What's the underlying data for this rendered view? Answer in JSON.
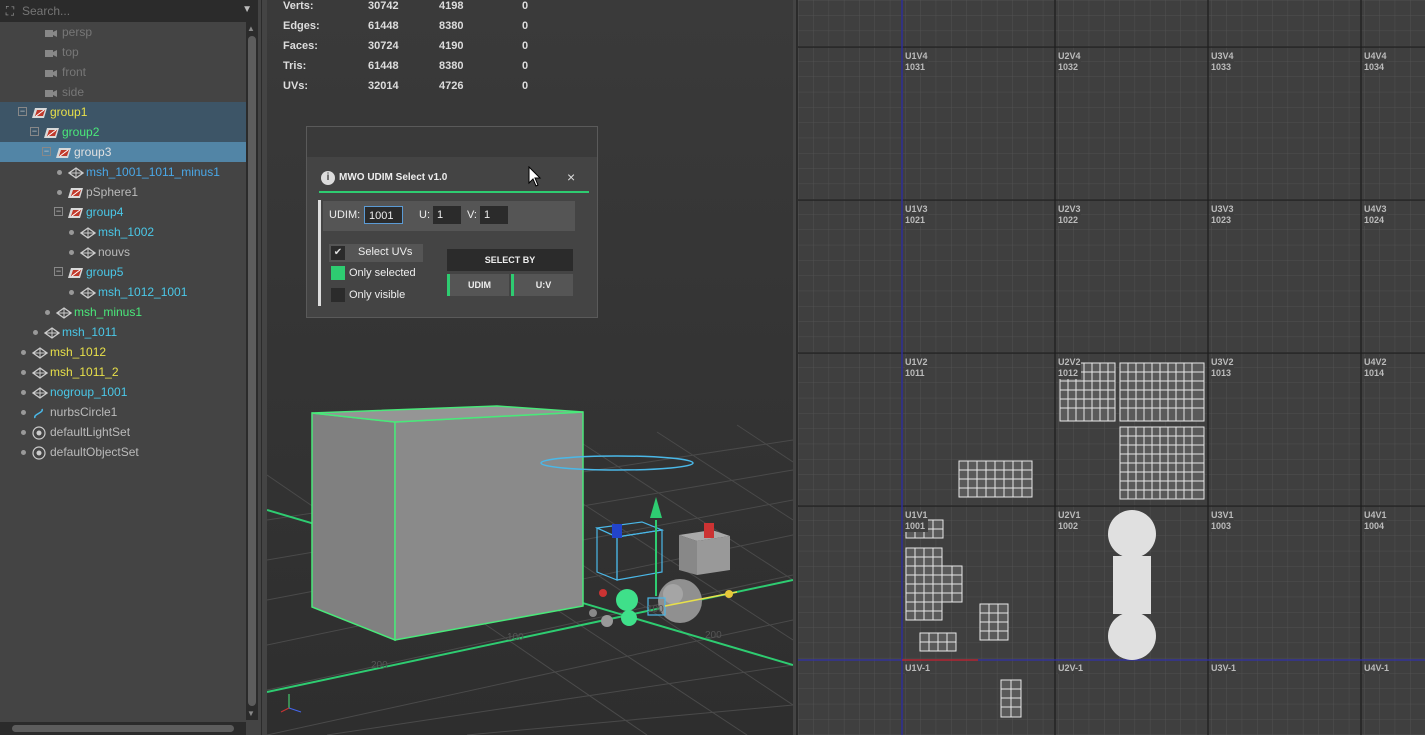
{
  "outliner": {
    "search_placeholder": "Search...",
    "items": [
      {
        "label": "persp",
        "color": "#777777",
        "icon": "camera-icon"
      },
      {
        "label": "top",
        "color": "#777777",
        "icon": "camera-icon"
      },
      {
        "label": "front",
        "color": "#777777",
        "icon": "camera-icon"
      },
      {
        "label": "side",
        "color": "#777777",
        "icon": "camera-icon"
      },
      {
        "label": "group1",
        "color": "#e8e04a",
        "icon": "group-icon"
      },
      {
        "label": "group2",
        "color": "#4ae87a",
        "icon": "group-icon"
      },
      {
        "label": "group3",
        "color": "#e0e0e0",
        "icon": "group-icon"
      },
      {
        "label": "msh_1001_1011_minus1",
        "color": "#4aa8e8",
        "icon": "mesh-icon"
      },
      {
        "label": "pSphere1",
        "color": "#bbbbbb",
        "icon": "group-icon"
      },
      {
        "label": "group4",
        "color": "#4ac8e8",
        "icon": "group-icon"
      },
      {
        "label": "msh_1002",
        "color": "#4ac8e8",
        "icon": "mesh-icon"
      },
      {
        "label": "nouvs",
        "color": "#bbbbbb",
        "icon": "mesh-icon"
      },
      {
        "label": "group5",
        "color": "#4ac8e8",
        "icon": "group-icon"
      },
      {
        "label": "msh_1012_1001",
        "color": "#4ac8e8",
        "icon": "mesh-icon"
      },
      {
        "label": "msh_minus1",
        "color": "#4ae87a",
        "icon": "mesh-icon"
      },
      {
        "label": "msh_1011",
        "color": "#4ac8e8",
        "icon": "mesh-icon"
      },
      {
        "label": "msh_1012",
        "color": "#e8e04a",
        "icon": "mesh-icon"
      },
      {
        "label": "msh_1011_2",
        "color": "#e8e04a",
        "icon": "mesh-icon"
      },
      {
        "label": "nogroup_1001",
        "color": "#4ac8e8",
        "icon": "mesh-icon"
      },
      {
        "label": "nurbsCircle1",
        "color": "#bbbbbb",
        "icon": "curve-icon"
      },
      {
        "label": "defaultLightSet",
        "color": "#bbbbbb",
        "icon": "set-icon"
      },
      {
        "label": "defaultObjectSet",
        "color": "#bbbbbb",
        "icon": "set-icon"
      }
    ]
  },
  "hud": {
    "rows": [
      {
        "label": "Verts:",
        "v1": "30742",
        "v2": "4198",
        "v3": "0"
      },
      {
        "label": "Edges:",
        "v1": "61448",
        "v2": "8380",
        "v3": "0"
      },
      {
        "label": "Faces:",
        "v1": "30724",
        "v2": "4190",
        "v3": "0"
      },
      {
        "label": "Tris:",
        "v1": "61448",
        "v2": "8380",
        "v3": "0"
      },
      {
        "label": "UVs:",
        "v1": "32014",
        "v2": "4726",
        "v3": "0"
      }
    ]
  },
  "viewport": {
    "grid_labels": [
      "200",
      "100",
      "100",
      "200"
    ]
  },
  "dialog": {
    "title": "MWO UDIM Select v1.0",
    "info_icon": "i",
    "close_icon": "×",
    "udim_label": "UDIM:",
    "udim_value": "1001",
    "u_label": "U:",
    "u_value": "1",
    "v_label": "V:",
    "v_value": "1",
    "select_uvs_label": "Select UVs",
    "only_selected_label": "Only selected",
    "only_visible_label": "Only visible",
    "select_by_label": "SELECT BY",
    "udim_button": "UDIM",
    "uv_button": "U:V",
    "accent": "#2ecc71"
  },
  "uv_tiles": {
    "row_labels": [
      [
        {
          "a": "U1V4",
          "b": "1031"
        },
        {
          "a": "U2V4",
          "b": "1032"
        },
        {
          "a": "U3V4",
          "b": "1033"
        },
        {
          "a": "U4V4",
          "b": "1034"
        }
      ],
      [
        {
          "a": "U1V3",
          "b": "1021"
        },
        {
          "a": "U2V3",
          "b": "1022"
        },
        {
          "a": "U3V3",
          "b": "1023"
        },
        {
          "a": "U4V3",
          "b": "1024"
        }
      ],
      [
        {
          "a": "U1V2",
          "b": "1011"
        },
        {
          "a": "U2V2",
          "b": "1012"
        },
        {
          "a": "U3V2",
          "b": "1013"
        },
        {
          "a": "U4V2",
          "b": "1014"
        }
      ],
      [
        {
          "a": "U1V1",
          "b": "1001"
        },
        {
          "a": "U2V1",
          "b": "1002"
        },
        {
          "a": "U3V1",
          "b": "1003"
        },
        {
          "a": "U4V1",
          "b": "1004"
        }
      ],
      [
        {
          "a": "U1V-1",
          "b": ""
        },
        {
          "a": "U2V-1",
          "b": ""
        },
        {
          "a": "U3V-1",
          "b": ""
        },
        {
          "a": "U4V-1",
          "b": ""
        }
      ]
    ]
  }
}
